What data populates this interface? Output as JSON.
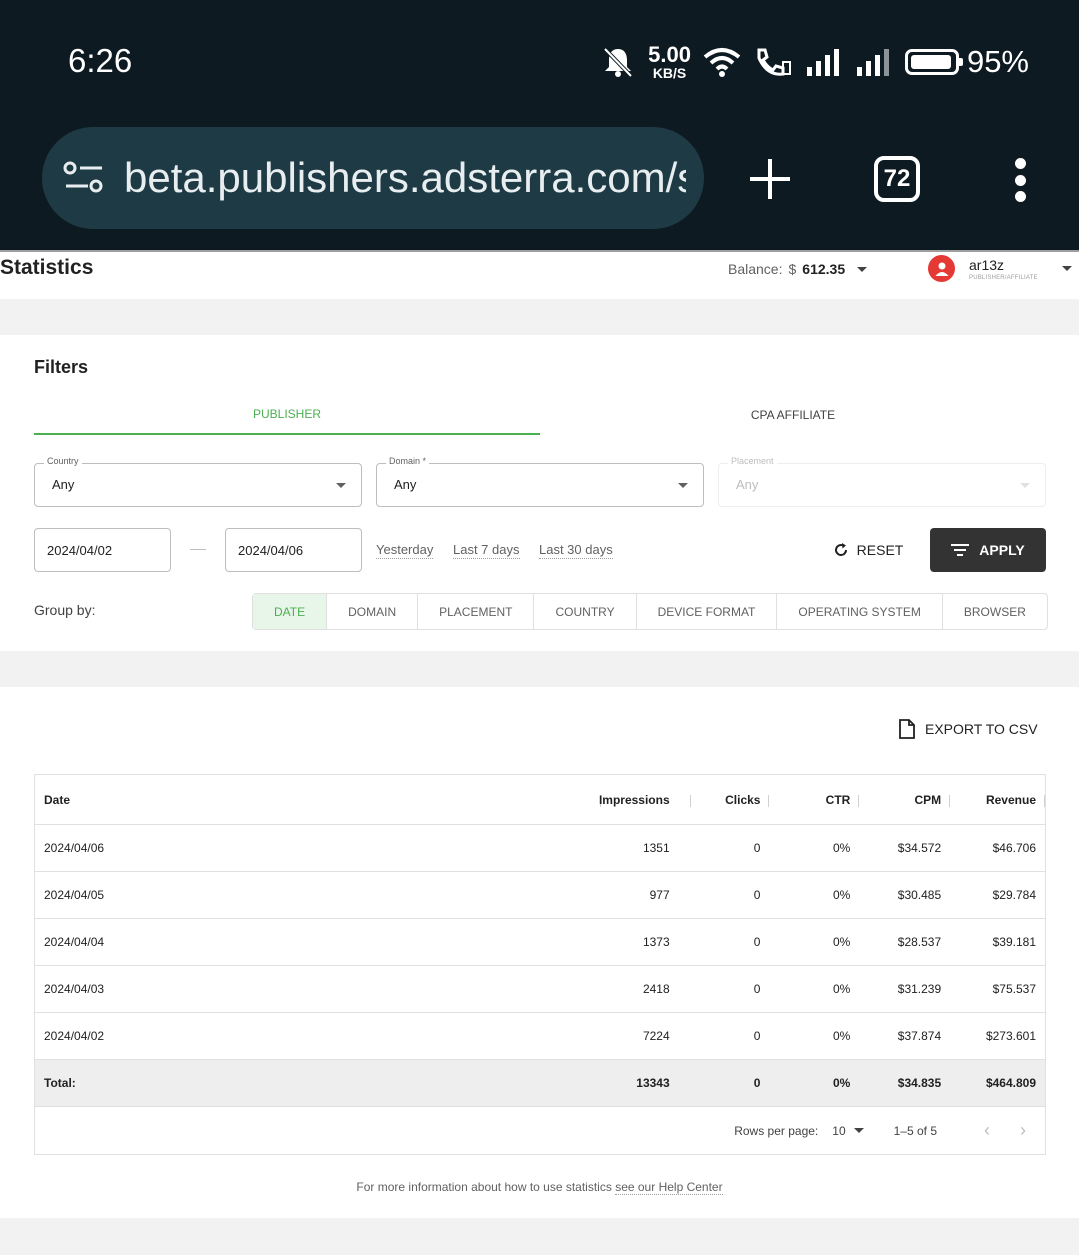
{
  "status_bar": {
    "time": "6:26",
    "speed_value": "5.00",
    "speed_unit": "KB/S",
    "battery_pct": "95%",
    "battery_level": 0.95
  },
  "browser": {
    "url": "beta.publishers.adsterra.com/s",
    "tab_count": "72"
  },
  "header": {
    "title": "Statistics",
    "balance_label": "Balance:",
    "balance_currency": "$",
    "balance_amount": "612.35",
    "user_name": "ar13z",
    "user_role": "PUBLISHER/AFFILIATE"
  },
  "filters": {
    "title": "Filters",
    "tabs": [
      {
        "label": "PUBLISHER",
        "active": true
      },
      {
        "label": "CPA AFFILIATE",
        "active": false
      }
    ],
    "country": {
      "label": "Country",
      "value": "Any"
    },
    "domain": {
      "label": "Domain *",
      "value": "Any"
    },
    "placement": {
      "label": "Placement",
      "value": "Any"
    },
    "date_from": "2024/04/02",
    "date_to": "2024/04/06",
    "quick_ranges": [
      "Yesterday",
      "Last 7 days",
      "Last 30 days"
    ],
    "reset_label": "RESET",
    "apply_label": "APPLY",
    "group_by_label": "Group by:",
    "group_by": [
      "DATE",
      "DOMAIN",
      "PLACEMENT",
      "COUNTRY",
      "DEVICE FORMAT",
      "OPERATING SYSTEM",
      "BROWSER"
    ],
    "group_by_active": "DATE"
  },
  "results": {
    "export_label": "EXPORT TO CSV",
    "columns": [
      "Date",
      "Impressions",
      "Clicks",
      "CTR",
      "CPM",
      "Revenue"
    ],
    "rows": [
      [
        "2024/04/06",
        "1351",
        "0",
        "0%",
        "$34.572",
        "$46.706"
      ],
      [
        "2024/04/05",
        "977",
        "0",
        "0%",
        "$30.485",
        "$29.784"
      ],
      [
        "2024/04/04",
        "1373",
        "0",
        "0%",
        "$28.537",
        "$39.181"
      ],
      [
        "2024/04/03",
        "2418",
        "0",
        "0%",
        "$31.239",
        "$75.537"
      ],
      [
        "2024/04/02",
        "7224",
        "0",
        "0%",
        "$37.874",
        "$273.601"
      ]
    ],
    "total": [
      "Total:",
      "13343",
      "0",
      "0%",
      "$34.835",
      "$464.809"
    ],
    "rows_per_page_label": "Rows per page:",
    "rows_per_page": "10",
    "page_range": "1–5 of 5",
    "help_prefix": "For more information about how to use statistics",
    "help_link": "see our Help Center"
  }
}
